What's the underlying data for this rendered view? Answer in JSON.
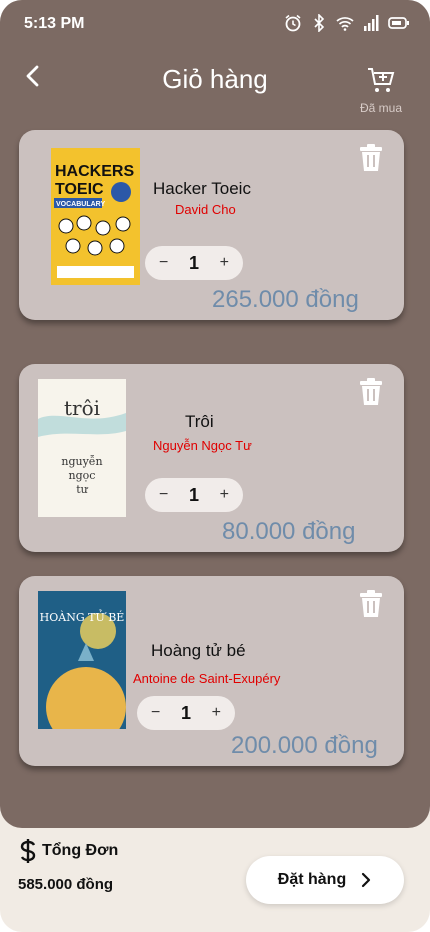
{
  "status": {
    "time": "5:13 PM"
  },
  "header": {
    "title": "Giỏ hàng",
    "bought_label": "Đã mua"
  },
  "cart": [
    {
      "title": "Hacker Toeic",
      "author": "David Cho",
      "qty": "1",
      "price": "265.000 đồng",
      "cover_lines": [
        "HACKERS",
        "TOEIC",
        "VOCABULARY"
      ]
    },
    {
      "title": "Trôi",
      "author": "Nguyễn Ngọc Tư",
      "qty": "1",
      "price": "80.000 đồng",
      "cover_lines": [
        "trôi",
        "nguyễn",
        "ngọc",
        "tư"
      ]
    },
    {
      "title": "Hoàng tử bé",
      "author": "Antoine de Saint-Exupéry",
      "qty": "1",
      "price": "200.000 đồng",
      "cover_lines": [
        "HOÀNG TỬ BÉ"
      ]
    }
  ],
  "footer": {
    "total_label": "Tổng Đơn",
    "total_value": "585.000 đồng",
    "order_label": "Đặt hàng"
  },
  "colors": {
    "background": "#7c6a63",
    "card": "#cbc1bf",
    "price": "#6f8caa",
    "author": "#e00000",
    "footer": "#f1ebe4"
  }
}
